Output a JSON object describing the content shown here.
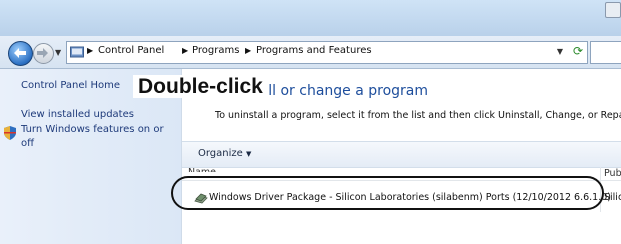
{
  "navbar": {
    "breadcrumbs": [
      "Control Panel",
      "Programs",
      "Programs and Features"
    ]
  },
  "sidebar": {
    "items": [
      {
        "label": "Control Panel Home"
      },
      {
        "label": "View installed updates"
      },
      {
        "label_line1": "Turn Windows features on or",
        "label_line2": "off",
        "icon": "shield-icon"
      }
    ]
  },
  "main": {
    "heading": "Uninstall or change a program",
    "instructions": "To uninstall a program, select it from the list and then click Uninstall, Change, or Repair.",
    "toolbar": {
      "organize_label": "Organize"
    },
    "columns": {
      "name": "Name",
      "publisher": "Pub"
    },
    "rows": [
      {
        "name": "Windows Driver Package - Silicon Laboratories (silabenm) Ports  (12/10/2012 6.6.1.0)",
        "publisher": "Silic",
        "icon": "driver-package-icon"
      }
    ]
  },
  "annotation": {
    "callout": "Double-click"
  },
  "colors": {
    "heading": "#1e4e9c",
    "link": "#1e3a7a",
    "navbar": "#d6e3f1"
  }
}
